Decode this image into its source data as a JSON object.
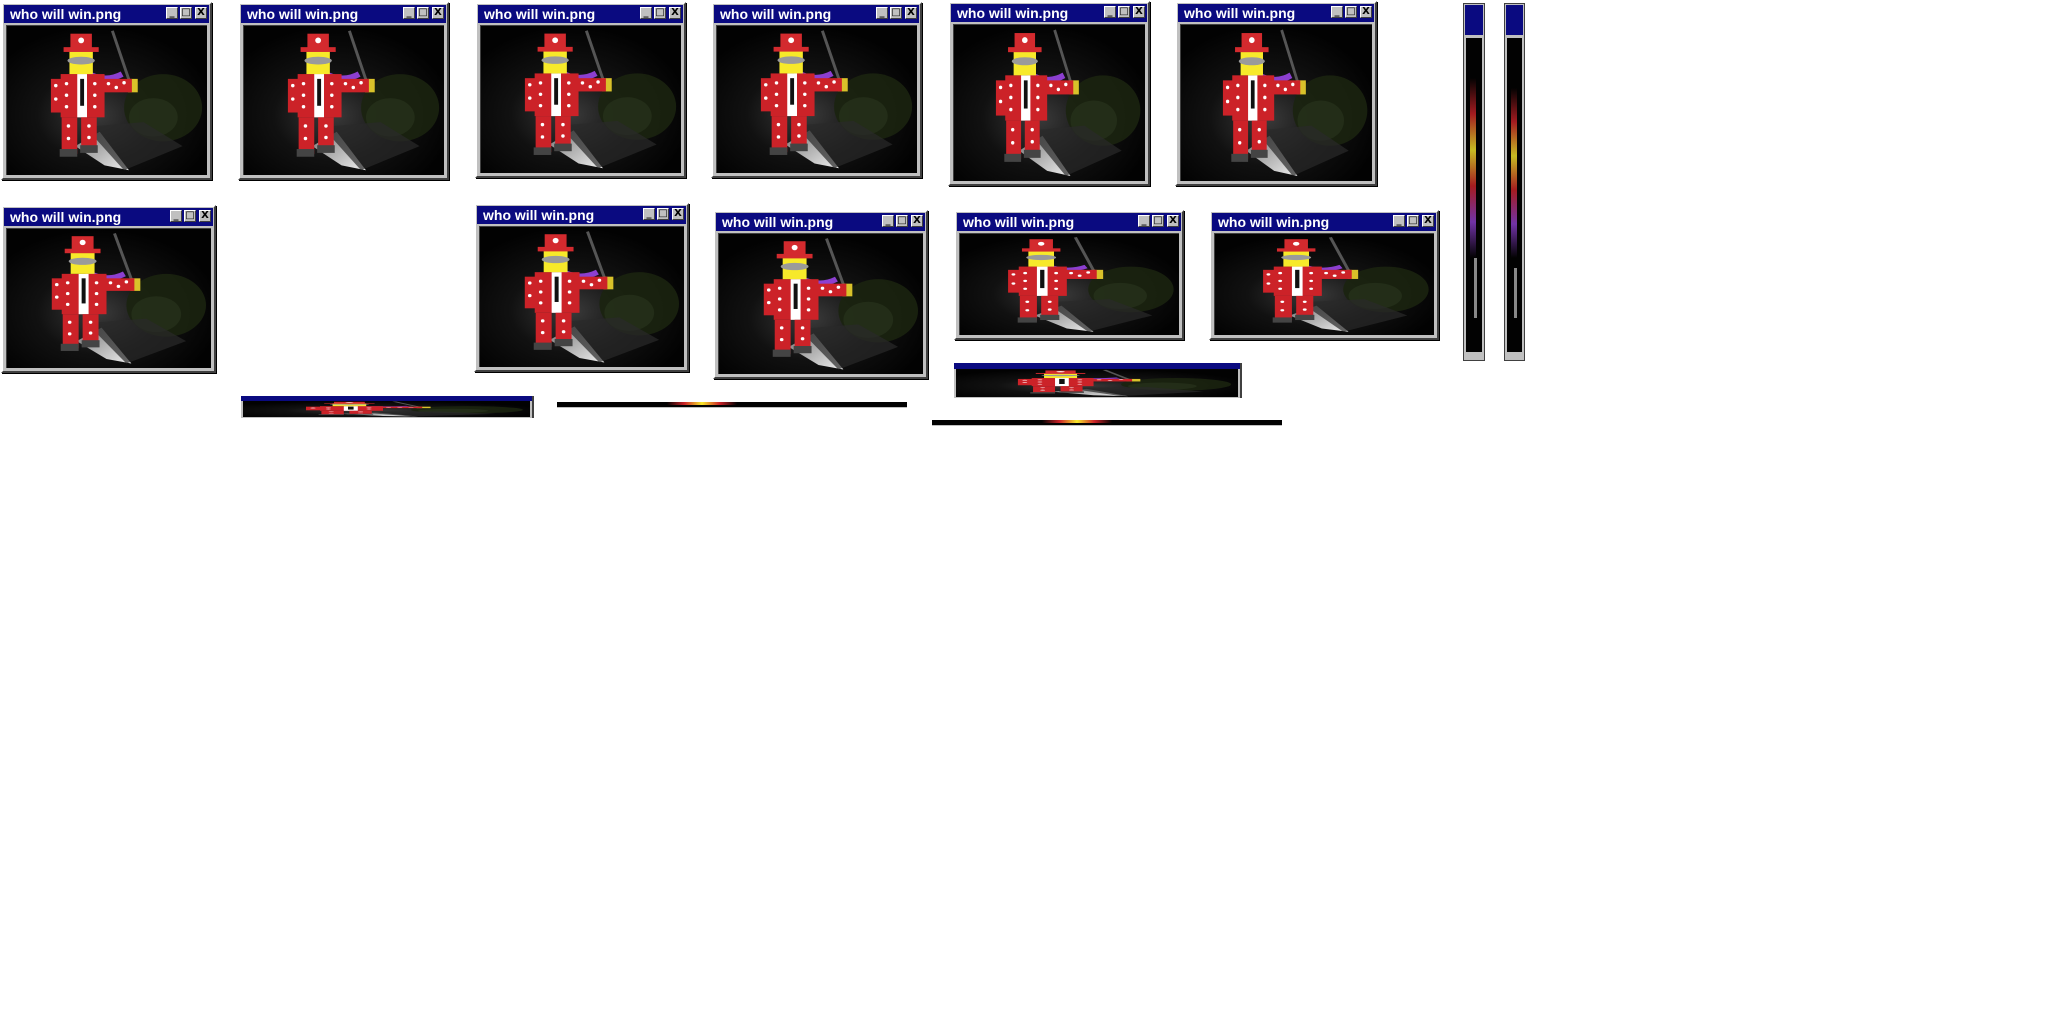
{
  "desktop": {
    "window_title": "who will win.png",
    "controls": {
      "minimize": "_",
      "maximize": "□",
      "close": "X"
    },
    "window_count": 12
  },
  "colors": {
    "titlebar": "#0a0a80",
    "chrome": "#c0c0c0",
    "suit": "#cc2228",
    "hat": "#d32a2e",
    "face": "#f7e92a",
    "scarf": "#8c3fd0",
    "background": "#020202"
  },
  "icons": [
    "minimize-icon",
    "maximize-icon",
    "close-icon"
  ]
}
